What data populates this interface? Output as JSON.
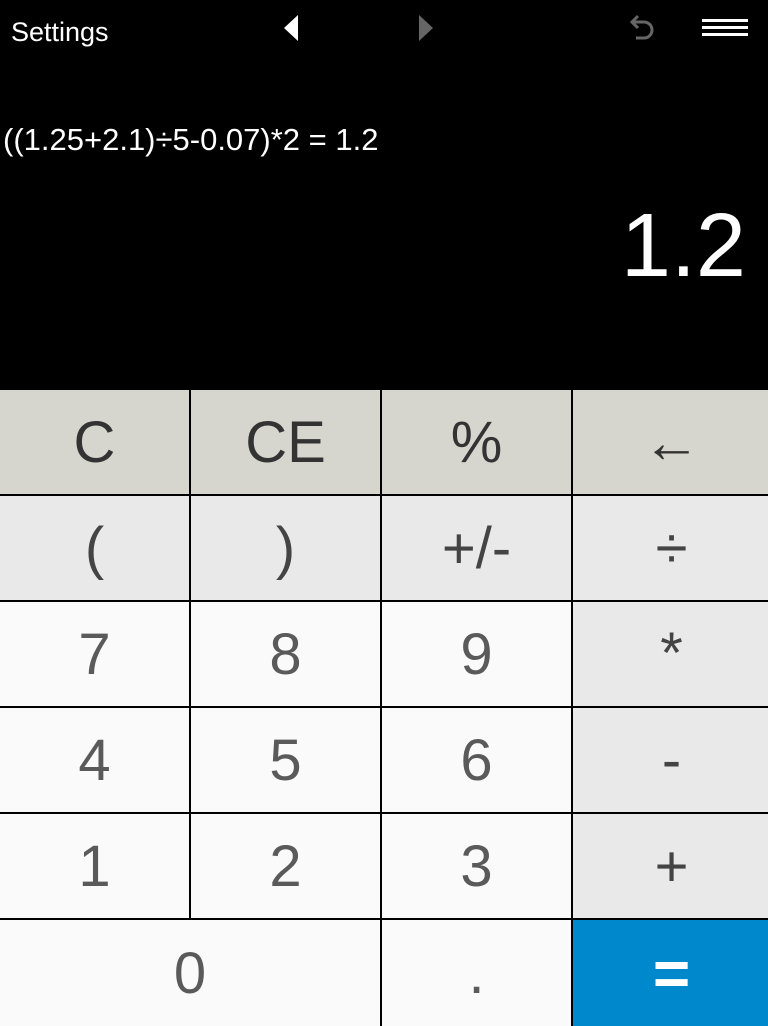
{
  "header": {
    "settings_label": "Settings",
    "icons": [
      "nav-back-icon",
      "nav-forward-icon",
      "undo-icon",
      "menu-icon"
    ],
    "nav_back_enabled": true,
    "nav_forward_enabled": false,
    "undo_enabled": false
  },
  "display": {
    "expression": "((1.25+2.1)÷5-0.07)*2 = 1.2",
    "result": "1.2"
  },
  "keys": {
    "c": "C",
    "ce": "CE",
    "percent": "%",
    "backspace": "←",
    "open_paren": "(",
    "close_paren": ")",
    "plus_minus": "+/-",
    "divide": "÷",
    "seven": "7",
    "eight": "8",
    "nine": "9",
    "multiply": "*",
    "four": "4",
    "five": "5",
    "six": "6",
    "minus": "-",
    "one": "1",
    "two": "2",
    "three": "3",
    "plus": "+",
    "zero": "0",
    "decimal": ".",
    "equals": "="
  },
  "colors": {
    "background": "#000000",
    "equals_accent": "#0088cc",
    "function_row": "#d6d6cf",
    "operator_keys": "#e9e9e9",
    "number_keys": "#fafafa"
  }
}
